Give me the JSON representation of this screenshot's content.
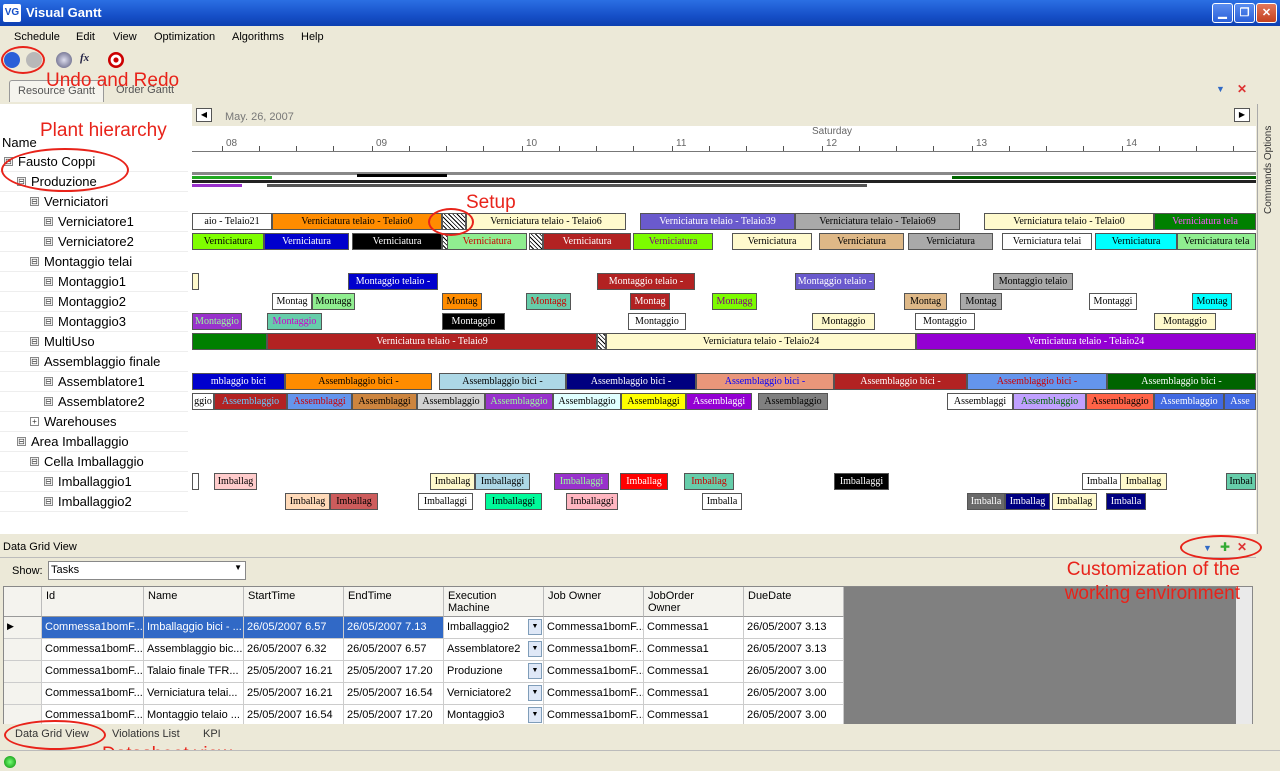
{
  "window": {
    "title": "Visual Gantt",
    "logo": "VG"
  },
  "menu": [
    "Schedule",
    "Edit",
    "View",
    "Optimization",
    "Algorithms",
    "Help"
  ],
  "annotations": {
    "undo_redo": "Undo and Redo",
    "plant_hierarchy": "Plant hierarchy",
    "setup": "Setup",
    "customization": "Customization of the working environment",
    "datasheet": "Datasheet view"
  },
  "tabs": {
    "resource": "Resource Gantt",
    "order": "Order Gantt"
  },
  "side_panel": "Commands Options",
  "gantt": {
    "date": "May. 26, 2007",
    "day": "Saturday",
    "hours": [
      "08",
      "09",
      "10",
      "11",
      "12",
      "13",
      "14"
    ],
    "name_header": "Name",
    "tree": [
      {
        "label": "Fausto Coppi",
        "level": 0,
        "box": "⊟"
      },
      {
        "label": "Produzione",
        "level": 1,
        "box": "⊟"
      },
      {
        "label": "Verniciatori",
        "level": 2,
        "box": "⊟"
      },
      {
        "label": "Verniciatore1",
        "level": 3,
        "box": "⊟"
      },
      {
        "label": "Verniciatore2",
        "level": 3,
        "box": "⊟"
      },
      {
        "label": "Montaggio telai",
        "level": 2,
        "box": "⊟"
      },
      {
        "label": "Montaggio1",
        "level": 3,
        "box": "⊟"
      },
      {
        "label": "Montaggio2",
        "level": 3,
        "box": "⊟"
      },
      {
        "label": "Montaggio3",
        "level": 3,
        "box": "⊟"
      },
      {
        "label": "MultiUso",
        "level": 2,
        "box": "⊟"
      },
      {
        "label": "Assemblaggio finale",
        "level": 2,
        "box": "⊟"
      },
      {
        "label": "Assemblatore1",
        "level": 3,
        "box": "⊟"
      },
      {
        "label": "Assemblatore2",
        "level": 3,
        "box": "⊟"
      },
      {
        "label": "Warehouses",
        "level": 2,
        "box": "+"
      },
      {
        "label": "Area Imballaggio",
        "level": 1,
        "box": "⊟"
      },
      {
        "label": "Cella Imballaggio",
        "level": 2,
        "box": "⊟"
      },
      {
        "label": "Imballaggio1",
        "level": 3,
        "box": "⊟"
      },
      {
        "label": "Imballaggio2",
        "level": 3,
        "box": "⊟"
      }
    ],
    "lanes": [
      {
        "row": 3,
        "tasks": [
          {
            "l": 0,
            "w": 80,
            "t": "aio - Telaio21",
            "bg": "#ffffff",
            "fg": "#000"
          },
          {
            "l": 80,
            "w": 170,
            "t": "Verniciatura telaio - Telaio0",
            "bg": "#ff8c00",
            "fg": "#000"
          },
          {
            "l": 250,
            "w": 24,
            "setup": true
          },
          {
            "l": 274,
            "w": 160,
            "t": "Verniciatura telaio - Telaio6",
            "bg": "#fffacd",
            "fg": "#000"
          },
          {
            "l": 448,
            "w": 155,
            "t": "Verniciatura telaio - Telaio39",
            "bg": "#6a5acd",
            "fg": "#fff"
          },
          {
            "l": 603,
            "w": 165,
            "t": "Verniciatura telaio - Telaio69",
            "bg": "#a9a9a9",
            "fg": "#000"
          },
          {
            "l": 792,
            "w": 170,
            "t": "Verniciatura telaio - Telaio0",
            "bg": "#fffacd",
            "fg": "#000"
          },
          {
            "l": 962,
            "w": 102,
            "t": "Verniciatura tela",
            "bg": "#008000",
            "fg": "#ff55ff"
          }
        ]
      },
      {
        "row": 4,
        "tasks": [
          {
            "l": 0,
            "w": 72,
            "t": "Verniciatura",
            "bg": "#7fff00",
            "fg": "#000"
          },
          {
            "l": 72,
            "w": 85,
            "t": "Verniciatura",
            "bg": "#0000cd",
            "fg": "#fff"
          },
          {
            "l": 160,
            "w": 90,
            "t": "Verniciatura",
            "bg": "#000000",
            "fg": "#fff"
          },
          {
            "l": 250,
            "w": 15,
            "setup": true
          },
          {
            "l": 255,
            "w": 80,
            "t": "Verniciatura",
            "bg": "#90ee90",
            "fg": "#c00"
          },
          {
            "l": 337,
            "w": 14,
            "setup": true
          },
          {
            "l": 351,
            "w": 88,
            "t": "Verniciatura",
            "bg": "#b22222",
            "fg": "#fff"
          },
          {
            "l": 441,
            "w": 80,
            "t": "Verniciatura",
            "bg": "#7cfc00",
            "fg": "#800080"
          },
          {
            "l": 540,
            "w": 80,
            "t": "Verniciatura",
            "bg": "#fffacd",
            "fg": "#000"
          },
          {
            "l": 627,
            "w": 85,
            "t": "Verniciatura",
            "bg": "#deb887",
            "fg": "#000"
          },
          {
            "l": 716,
            "w": 85,
            "t": "Verniciatura",
            "bg": "#a9a9a9",
            "fg": "#000"
          },
          {
            "l": 810,
            "w": 90,
            "t": "Verniciatura telai",
            "bg": "#ffffff",
            "fg": "#000"
          },
          {
            "l": 903,
            "w": 82,
            "t": "Verniciatura",
            "bg": "#00ffff",
            "fg": "#000"
          },
          {
            "l": 985,
            "w": 79,
            "t": "Verniciatura tela",
            "bg": "#90ee90",
            "fg": "#000"
          }
        ]
      },
      {
        "row": 6,
        "tasks": [
          {
            "l": 0,
            "w": 7,
            "t": "",
            "bg": "#fffacd",
            "fg": "#000"
          },
          {
            "l": 156,
            "w": 90,
            "t": "Montaggio telaio -",
            "bg": "#0000cd",
            "fg": "#fff"
          },
          {
            "l": 405,
            "w": 98,
            "t": "Montaggio telaio -",
            "bg": "#b22222",
            "fg": "#fff"
          },
          {
            "l": 603,
            "w": 80,
            "t": "Montaggio telaio -",
            "bg": "#6a5acd",
            "fg": "#fff"
          },
          {
            "l": 801,
            "w": 80,
            "t": "Montaggio telaio",
            "bg": "#a9a9a9",
            "fg": "#000"
          }
        ]
      },
      {
        "row": 7,
        "tasks": [
          {
            "l": 80,
            "w": 40,
            "t": "Montag",
            "bg": "#ffffff",
            "fg": "#000"
          },
          {
            "l": 120,
            "w": 43,
            "t": "Montagg",
            "bg": "#90ee90",
            "fg": "#000"
          },
          {
            "l": 250,
            "w": 40,
            "t": "Montag",
            "bg": "#ff8c00",
            "fg": "#000"
          },
          {
            "l": 334,
            "w": 45,
            "t": "Montagg",
            "bg": "#66cdaa",
            "fg": "#c00"
          },
          {
            "l": 438,
            "w": 40,
            "t": "Montag",
            "bg": "#b22222",
            "fg": "#fff"
          },
          {
            "l": 520,
            "w": 45,
            "t": "Montagg",
            "bg": "#7cfc00",
            "fg": "#800080"
          },
          {
            "l": 712,
            "w": 43,
            "t": "Montag",
            "bg": "#deb887",
            "fg": "#000"
          },
          {
            "l": 768,
            "w": 42,
            "t": "Montag",
            "bg": "#a9a9a9",
            "fg": "#000"
          },
          {
            "l": 897,
            "w": 48,
            "t": "Montaggi",
            "bg": "#ffffff",
            "fg": "#000"
          },
          {
            "l": 1000,
            "w": 40,
            "t": "Montag",
            "bg": "#00ffff",
            "fg": "#000"
          }
        ]
      },
      {
        "row": 8,
        "tasks": [
          {
            "l": 0,
            "w": 50,
            "t": "Montaggio",
            "bg": "#9932cc",
            "fg": "#9f9"
          },
          {
            "l": 75,
            "w": 55,
            "t": "Montaggio",
            "bg": "#66cdaa",
            "fg": "#c0c"
          },
          {
            "l": 250,
            "w": 63,
            "t": "Montaggio",
            "bg": "#000000",
            "fg": "#fff"
          },
          {
            "l": 436,
            "w": 58,
            "t": "Montaggio",
            "bg": "#ffffff",
            "fg": "#000"
          },
          {
            "l": 620,
            "w": 63,
            "t": "Montaggio",
            "bg": "#fffacd",
            "fg": "#000"
          },
          {
            "l": 723,
            "w": 60,
            "t": "Montaggio",
            "bg": "#ffffff",
            "fg": "#000"
          },
          {
            "l": 962,
            "w": 62,
            "t": "Montaggio",
            "bg": "#fffacd",
            "fg": "#000"
          }
        ]
      },
      {
        "row": 9,
        "tasks": [
          {
            "l": 0,
            "w": 75,
            "t": "",
            "bg": "#008000",
            "fg": "#000"
          },
          {
            "l": 75,
            "w": 330,
            "t": "Verniciatura telaio - Telaio9",
            "bg": "#b22222",
            "fg": "#fff"
          },
          {
            "l": 405,
            "w": 9,
            "setup": true
          },
          {
            "l": 414,
            "w": 310,
            "t": "Verniciatura telaio - Telaio24",
            "bg": "#fffacd",
            "fg": "#000"
          },
          {
            "l": 724,
            "w": 340,
            "t": "Verniciatura telaio - Telaio24",
            "bg": "#9400d3",
            "fg": "#fff"
          }
        ]
      },
      {
        "row": 11,
        "tasks": [
          {
            "l": 0,
            "w": 93,
            "t": "mblaggio bici",
            "bg": "#0000cd",
            "fg": "#fff"
          },
          {
            "l": 93,
            "w": 147,
            "t": "Assemblaggio bici -",
            "bg": "#ff8c00",
            "fg": "#000"
          },
          {
            "l": 247,
            "w": 127,
            "t": "Assemblaggio bici -",
            "bg": "#add8e6",
            "fg": "#000"
          },
          {
            "l": 374,
            "w": 130,
            "t": "Assemblaggio bici -",
            "bg": "#000080",
            "fg": "#fff"
          },
          {
            "l": 504,
            "w": 138,
            "t": "Assemblaggio bici -",
            "bg": "#e9967a",
            "fg": "#00f"
          },
          {
            "l": 642,
            "w": 133,
            "t": "Assemblaggio bici -",
            "bg": "#b22222",
            "fg": "#fff"
          },
          {
            "l": 775,
            "w": 140,
            "t": "Assemblaggio bici -",
            "bg": "#6495ed",
            "fg": "#c00"
          },
          {
            "l": 915,
            "w": 149,
            "t": "Assemblaggio bici -",
            "bg": "#006400",
            "fg": "#fff"
          }
        ]
      },
      {
        "row": 12,
        "tasks": [
          {
            "l": 0,
            "w": 22,
            "t": "ggio",
            "bg": "#ffffff",
            "fg": "#000"
          },
          {
            "l": 22,
            "w": 73,
            "t": "Assemblaggio",
            "bg": "#b22222",
            "fg": "#6cf"
          },
          {
            "l": 95,
            "w": 65,
            "t": "Assemblaggi",
            "bg": "#6495ed",
            "fg": "#c00"
          },
          {
            "l": 160,
            "w": 65,
            "t": "Assemblaggi",
            "bg": "#cd853f",
            "fg": "#000"
          },
          {
            "l": 225,
            "w": 68,
            "t": "Assemblaggio",
            "bg": "#d3d3d3",
            "fg": "#000"
          },
          {
            "l": 293,
            "w": 68,
            "t": "Assemblaggio",
            "bg": "#9932cc",
            "fg": "#9f9"
          },
          {
            "l": 361,
            "w": 68,
            "t": "Assemblaggio",
            "bg": "#e0ffff",
            "fg": "#000"
          },
          {
            "l": 429,
            "w": 65,
            "t": "Assemblaggi",
            "bg": "#ffff00",
            "fg": "#000"
          },
          {
            "l": 494,
            "w": 66,
            "t": "Assemblaggi",
            "bg": "#9400d3",
            "fg": "#fff"
          },
          {
            "l": 566,
            "w": 70,
            "t": "Assemblaggio",
            "bg": "#808080",
            "fg": "#000"
          },
          {
            "l": 755,
            "w": 66,
            "t": "Assemblaggi",
            "bg": "#ffffff",
            "fg": "#000"
          },
          {
            "l": 821,
            "w": 73,
            "t": "Assemblaggio",
            "bg": "#c0a0ff",
            "fg": "#060"
          },
          {
            "l": 894,
            "w": 68,
            "t": "Assemblaggio",
            "bg": "#ff6347",
            "fg": "#000"
          },
          {
            "l": 962,
            "w": 70,
            "t": "Assemblaggio",
            "bg": "#4169e1",
            "fg": "#fff"
          },
          {
            "l": 1032,
            "w": 32,
            "t": "Asse",
            "bg": "#4169e1",
            "fg": "#fff"
          }
        ]
      },
      {
        "row": 16,
        "tasks": [
          {
            "l": 0,
            "w": 7,
            "t": "",
            "bg": "#fff",
            "fg": "#000"
          },
          {
            "l": 22,
            "w": 43,
            "t": "Imballag",
            "bg": "#ffcccc",
            "fg": "#000"
          },
          {
            "l": 238,
            "w": 45,
            "t": "Imballag",
            "bg": "#fffacd",
            "fg": "#000"
          },
          {
            "l": 283,
            "w": 55,
            "t": "Imballaggi",
            "bg": "#add8e6",
            "fg": "#000"
          },
          {
            "l": 362,
            "w": 55,
            "t": "Imballaggi",
            "bg": "#9932cc",
            "fg": "#9f9"
          },
          {
            "l": 428,
            "w": 48,
            "t": "Imballag",
            "bg": "#ff0000",
            "fg": "#fff"
          },
          {
            "l": 492,
            "w": 50,
            "t": "Imballag",
            "bg": "#66cdaa",
            "fg": "#c00"
          },
          {
            "l": 642,
            "w": 55,
            "t": "Imballaggi",
            "bg": "#000000",
            "fg": "#fff"
          },
          {
            "l": 890,
            "w": 40,
            "t": "Imballa",
            "bg": "#ffffff",
            "fg": "#000"
          },
          {
            "l": 928,
            "w": 47,
            "t": "Imballag",
            "bg": "#fffacd",
            "fg": "#000"
          },
          {
            "l": 1034,
            "w": 30,
            "t": "Imbal",
            "bg": "#66cdaa",
            "fg": "#000"
          }
        ]
      },
      {
        "row": 17,
        "tasks": [
          {
            "l": 93,
            "w": 45,
            "t": "Imballag",
            "bg": "#ffdab9",
            "fg": "#000"
          },
          {
            "l": 138,
            "w": 48,
            "t": "Imballag",
            "bg": "#cd5c5c",
            "fg": "#000"
          },
          {
            "l": 226,
            "w": 55,
            "t": "Imballaggi",
            "bg": "#ffffff",
            "fg": "#000"
          },
          {
            "l": 293,
            "w": 57,
            "t": "Imballaggi",
            "bg": "#00fa9a",
            "fg": "#000"
          },
          {
            "l": 374,
            "w": 52,
            "t": "Imballaggi",
            "bg": "#ffb6c1",
            "fg": "#000"
          },
          {
            "l": 510,
            "w": 40,
            "t": "Imballa",
            "bg": "#ffffff",
            "fg": "#000"
          },
          {
            "l": 775,
            "w": 38,
            "t": "Imballa",
            "bg": "#696969",
            "fg": "#fff"
          },
          {
            "l": 813,
            "w": 45,
            "t": "Imballag",
            "bg": "#000080",
            "fg": "#fff"
          },
          {
            "l": 860,
            "w": 45,
            "t": "Imballag",
            "bg": "#fffacd",
            "fg": "#000"
          },
          {
            "l": 914,
            "w": 40,
            "t": "Imballa",
            "bg": "#000080",
            "fg": "#fff"
          }
        ]
      }
    ]
  },
  "data_grid": {
    "title": "Data Grid View",
    "show_label": "Show:",
    "show_value": "Tasks",
    "columns": [
      "Id",
      "Name",
      "StartTime",
      "EndTime",
      "Execution\nMachine",
      "Job Owner",
      "JobOrder\nOwner",
      "DueDate"
    ],
    "rows": [
      [
        "Commessa1bomF...",
        "Imballaggio bici - ...",
        "26/05/2007 6.57",
        "26/05/2007 7.13",
        "Imballaggio2",
        "Commessa1bomF...",
        "Commessa1",
        "26/05/2007 3.13"
      ],
      [
        "Commessa1bomF...",
        "Assemblaggio bic...",
        "26/05/2007 6.32",
        "26/05/2007 6.57",
        "Assemblatore2",
        "Commessa1bomF...",
        "Commessa1",
        "26/05/2007 3.13"
      ],
      [
        "Commessa1bomF...",
        "Talaio finale TFR...",
        "25/05/2007 16.21",
        "25/05/2007 17.20",
        "Produzione",
        "Commessa1bomF...",
        "Commessa1",
        "26/05/2007 3.00"
      ],
      [
        "Commessa1bomF...",
        "Verniciatura telai...",
        "25/05/2007 16.21",
        "25/05/2007 16.54",
        "Verniciatore2",
        "Commessa1bomF...",
        "Commessa1",
        "26/05/2007 3.00"
      ],
      [
        "Commessa1bomF...",
        "Montaggio telaio ...",
        "25/05/2007 16.54",
        "25/05/2007 17.20",
        "Montaggio3",
        "Commessa1bomF...",
        "Commessa1",
        "26/05/2007 3.00"
      ]
    ]
  },
  "bottom_tabs": [
    "Data Grid View",
    "Violations List",
    "KPI"
  ]
}
